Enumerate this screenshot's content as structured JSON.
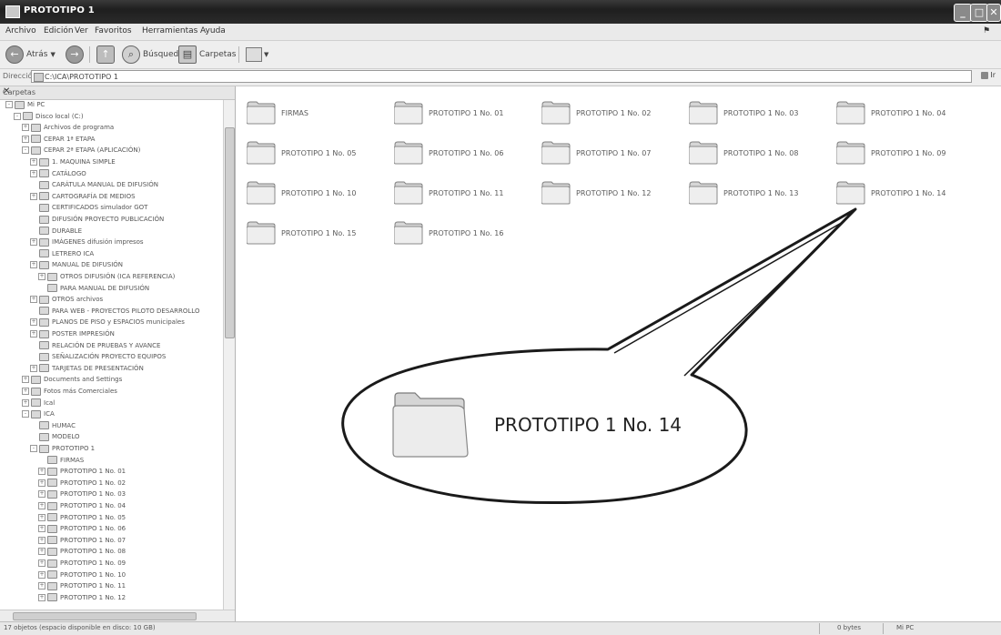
{
  "window": {
    "title": "PROTOTIPO 1",
    "min": "_",
    "max": "□",
    "close": "✕"
  },
  "menu": [
    "Archivo",
    "Edición",
    "Ver",
    "Favoritos",
    "Herramientas",
    "Ayuda"
  ],
  "toolbar": {
    "back": "Atrás",
    "search": "Búsqueda",
    "folders": "Carpetas"
  },
  "address": {
    "label": "Dirección",
    "path": "C:\\ICA\\PROTOTIPO 1",
    "go": "Ir"
  },
  "left_pane": {
    "title": "Carpetas",
    "close": "✕",
    "tree": [
      {
        "label": "Mi PC",
        "level": 0,
        "exp": "-"
      },
      {
        "label": "Disco local (C:)",
        "level": 1,
        "exp": "-"
      },
      {
        "label": "Archivos de programa",
        "level": 2,
        "exp": "+"
      },
      {
        "label": "CEPAR 1ª ETAPA",
        "level": 2,
        "exp": "+"
      },
      {
        "label": "CEPAR 2ª ETAPA (APLICACIÓN)",
        "level": 2,
        "exp": "-"
      },
      {
        "label": "1. MAQUINA SIMPLE",
        "level": 3,
        "exp": "+"
      },
      {
        "label": "CATÁLOGO",
        "level": 3,
        "exp": "+"
      },
      {
        "label": "CARÁTULA MANUAL DE DIFUSIÓN",
        "level": 3,
        "exp": ""
      },
      {
        "label": "CARTOGRAFÍA DE MEDIOS",
        "level": 3,
        "exp": "+"
      },
      {
        "label": "CERTIFICADOS simulador GOT",
        "level": 3,
        "exp": ""
      },
      {
        "label": "DIFUSIÓN PROYECTO PUBLICACIÓN",
        "level": 3,
        "exp": ""
      },
      {
        "label": "DURABLE",
        "level": 3,
        "exp": ""
      },
      {
        "label": "IMÁGENES difusión impresos",
        "level": 3,
        "exp": "+"
      },
      {
        "label": "LETRERO ICA",
        "level": 3,
        "exp": ""
      },
      {
        "label": "MANUAL DE DIFUSIÓN",
        "level": 3,
        "exp": "+"
      },
      {
        "label": "OTROS DIFUSIÓN (ICA REFERENCIA)",
        "level": 4,
        "exp": "+"
      },
      {
        "label": "PARA MANUAL DE DIFUSIÓN",
        "level": 4,
        "exp": ""
      },
      {
        "label": "OTROS archivos",
        "level": 3,
        "exp": "+"
      },
      {
        "label": "PARA WEB - PROYECTOS PILOTO DESARROLLO",
        "level": 3,
        "exp": ""
      },
      {
        "label": "PLANOS DE PISO y ESPACIOS municipales",
        "level": 3,
        "exp": "+"
      },
      {
        "label": "POSTER IMPRESIÓN",
        "level": 3,
        "exp": "+"
      },
      {
        "label": "RELACIÓN DE PRUEBAS Y AVANCE",
        "level": 3,
        "exp": ""
      },
      {
        "label": "SEÑALIZACIÓN PROYECTO EQUIPOS",
        "level": 3,
        "exp": ""
      },
      {
        "label": "TARJETAS DE PRESENTACIÓN",
        "level": 3,
        "exp": "+"
      },
      {
        "label": "Documents and Settings",
        "level": 2,
        "exp": "+"
      },
      {
        "label": "Fotos más Comerciales",
        "level": 2,
        "exp": "+"
      },
      {
        "label": "Ical",
        "level": 2,
        "exp": "+"
      },
      {
        "label": "ICA",
        "level": 2,
        "exp": "-"
      },
      {
        "label": "HUMAC",
        "level": 3,
        "exp": ""
      },
      {
        "label": "MODELO",
        "level": 3,
        "exp": ""
      },
      {
        "label": "PROTOTIPO 1",
        "level": 3,
        "exp": "-"
      },
      {
        "label": "FIRMAS",
        "level": 4,
        "exp": ""
      },
      {
        "label": "PROTOTIPO 1 No. 01",
        "level": 4,
        "exp": "+"
      },
      {
        "label": "PROTOTIPO 1 No. 02",
        "level": 4,
        "exp": "+"
      },
      {
        "label": "PROTOTIPO 1 No. 03",
        "level": 4,
        "exp": "+"
      },
      {
        "label": "PROTOTIPO 1 No. 04",
        "level": 4,
        "exp": "+"
      },
      {
        "label": "PROTOTIPO 1 No. 05",
        "level": 4,
        "exp": "+"
      },
      {
        "label": "PROTOTIPO 1 No. 06",
        "level": 4,
        "exp": "+"
      },
      {
        "label": "PROTOTIPO 1 No. 07",
        "level": 4,
        "exp": "+"
      },
      {
        "label": "PROTOTIPO 1 No. 08",
        "level": 4,
        "exp": "+"
      },
      {
        "label": "PROTOTIPO 1 No. 09",
        "level": 4,
        "exp": "+"
      },
      {
        "label": "PROTOTIPO 1 No. 10",
        "level": 4,
        "exp": "+"
      },
      {
        "label": "PROTOTIPO 1 No. 11",
        "level": 4,
        "exp": "+"
      },
      {
        "label": "PROTOTIPO 1 No. 12",
        "level": 4,
        "exp": "+"
      }
    ]
  },
  "folders": [
    "FIRMAS",
    "PROTOTIPO 1 No. 01",
    "PROTOTIPO 1 No. 02",
    "PROTOTIPO 1 No. 03",
    "PROTOTIPO 1 No. 04",
    "PROTOTIPO 1 No. 05",
    "PROTOTIPO 1 No. 06",
    "PROTOTIPO 1 No. 07",
    "PROTOTIPO 1 No. 08",
    "PROTOTIPO 1 No. 09",
    "PROTOTIPO 1 No. 10",
    "PROTOTIPO 1 No. 11",
    "PROTOTIPO 1 No. 12",
    "PROTOTIPO 1 No. 13",
    "PROTOTIPO 1 No. 14",
    "PROTOTIPO 1 No. 15",
    "PROTOTIPO 1 No. 16"
  ],
  "callout": {
    "label": "PROTOTIPO 1 No. 14"
  },
  "status": {
    "left": "17 objetos (espacio disponible en disco: 10 GB)",
    "middle": "0 bytes",
    "right": "Mi PC"
  }
}
